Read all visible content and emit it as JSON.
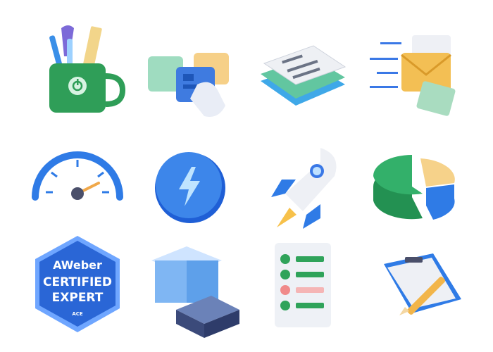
{
  "colors": {
    "green": "#2fa35a",
    "blue": "#2f7be6",
    "light_blue": "#7cb8f2",
    "yellow": "#f6c560",
    "red": "#f08a8a",
    "mint": "#a9dcc0",
    "navy": "#3b4a7a"
  },
  "icons": [
    {
      "name": "pencil-cup-icon"
    },
    {
      "name": "drag-cards-icon"
    },
    {
      "name": "document-stack-icon"
    },
    {
      "name": "flying-envelopes-icon"
    },
    {
      "name": "speedometer-icon"
    },
    {
      "name": "lightning-coin-icon"
    },
    {
      "name": "rocket-icon"
    },
    {
      "name": "pie-chart-icon"
    },
    {
      "name": "certified-badge-icon"
    },
    {
      "name": "open-boxes-icon"
    },
    {
      "name": "checklist-icon"
    },
    {
      "name": "clipboard-pencil-icon"
    }
  ],
  "badge": {
    "brand": "AWeber",
    "line1": "CERTIFIED",
    "line2": "EXPERT",
    "footer": "ACE"
  }
}
